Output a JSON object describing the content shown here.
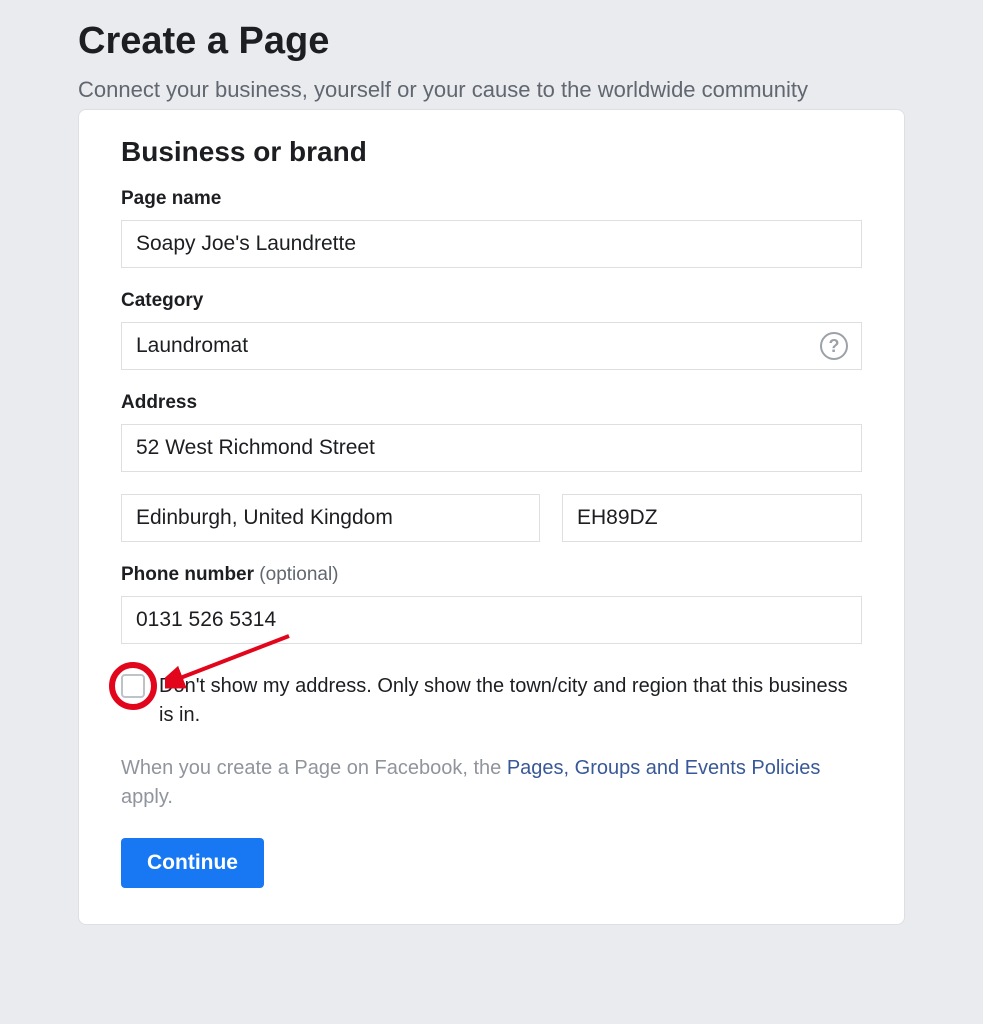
{
  "header": {
    "title": "Create a Page",
    "subtitle": "Connect your business, yourself or your cause to the worldwide community"
  },
  "form": {
    "section_title": "Business or brand",
    "page_name": {
      "label": "Page name",
      "value": "Soapy Joe's Laundrette"
    },
    "category": {
      "label": "Category",
      "value": "Laundromat"
    },
    "address": {
      "label": "Address",
      "street": "52 West Richmond Street",
      "city": "Edinburgh, United Kingdom",
      "zip": "EH89DZ"
    },
    "phone": {
      "label": "Phone number",
      "optional": " (optional)",
      "value": "0131 526 5314"
    },
    "hide_address": {
      "label": "Don't show my address. Only show the town/city and region that this business is in."
    },
    "policy": {
      "prefix": "When you create a Page on Facebook, the ",
      "link": "Pages, Groups and Events Policies",
      "suffix": " apply."
    },
    "continue_label": "Continue"
  }
}
